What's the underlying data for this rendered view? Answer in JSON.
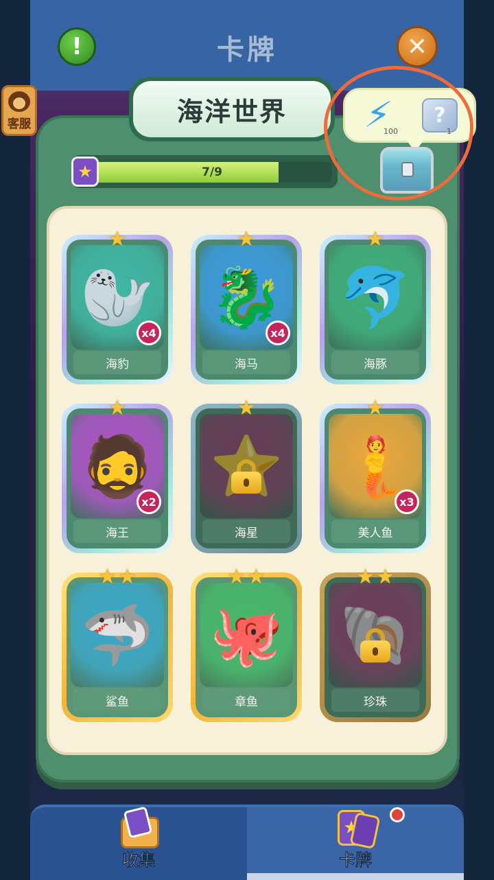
{
  "header": {
    "title": "卡牌",
    "info_label": "!",
    "close_label": "✕"
  },
  "customer_service": {
    "label": "客服"
  },
  "album": {
    "title": "海洋世界",
    "progress_text": "7/9",
    "progress_value": 0.778
  },
  "rewards": {
    "energy_count": "100",
    "mystery_count": "1",
    "mystery_symbol": "?"
  },
  "cards": [
    {
      "name": "海豹",
      "stars": 1,
      "count": "x4",
      "locked": false,
      "tier": "silver",
      "icon": "🦭",
      "bg": "#3fb7a6"
    },
    {
      "name": "海马",
      "stars": 1,
      "count": "x4",
      "locked": false,
      "tier": "silver",
      "icon": "🐉",
      "bg": "#3b9ae1"
    },
    {
      "name": "海豚",
      "stars": 1,
      "count": "",
      "locked": false,
      "tier": "silver",
      "icon": "🐬",
      "bg": "#3eae7a"
    },
    {
      "name": "海王",
      "stars": 1,
      "count": "x2",
      "locked": false,
      "tier": "silver",
      "icon": "🧔",
      "bg": "#b04fc8"
    },
    {
      "name": "海星",
      "stars": 1,
      "count": "",
      "locked": true,
      "tier": "silver",
      "icon": "⭐",
      "bg": "#b25a8e"
    },
    {
      "name": "美人鱼",
      "stars": 1,
      "count": "x3",
      "locked": false,
      "tier": "silver",
      "icon": "🧜",
      "bg": "#f0a73a"
    },
    {
      "name": "鲨鱼",
      "stars": 2,
      "count": "",
      "locked": false,
      "tier": "gold",
      "icon": "🦈",
      "bg": "#3aa7c9"
    },
    {
      "name": "章鱼",
      "stars": 2,
      "count": "",
      "locked": false,
      "tier": "gold",
      "icon": "🐙",
      "bg": "#46b86a"
    },
    {
      "name": "珍珠",
      "stars": 2,
      "count": "",
      "locked": true,
      "tier": "gold",
      "icon": "🐚",
      "bg": "#c25a97"
    }
  ],
  "bottom_tabs": [
    {
      "label": "收集",
      "active": false
    },
    {
      "label": "卡牌",
      "active": true,
      "badge": true
    }
  ],
  "colors": {
    "annotation_circle": "#ef6b3b",
    "panel_green": "#4e8f6e",
    "badge_red": "#c8245c"
  }
}
